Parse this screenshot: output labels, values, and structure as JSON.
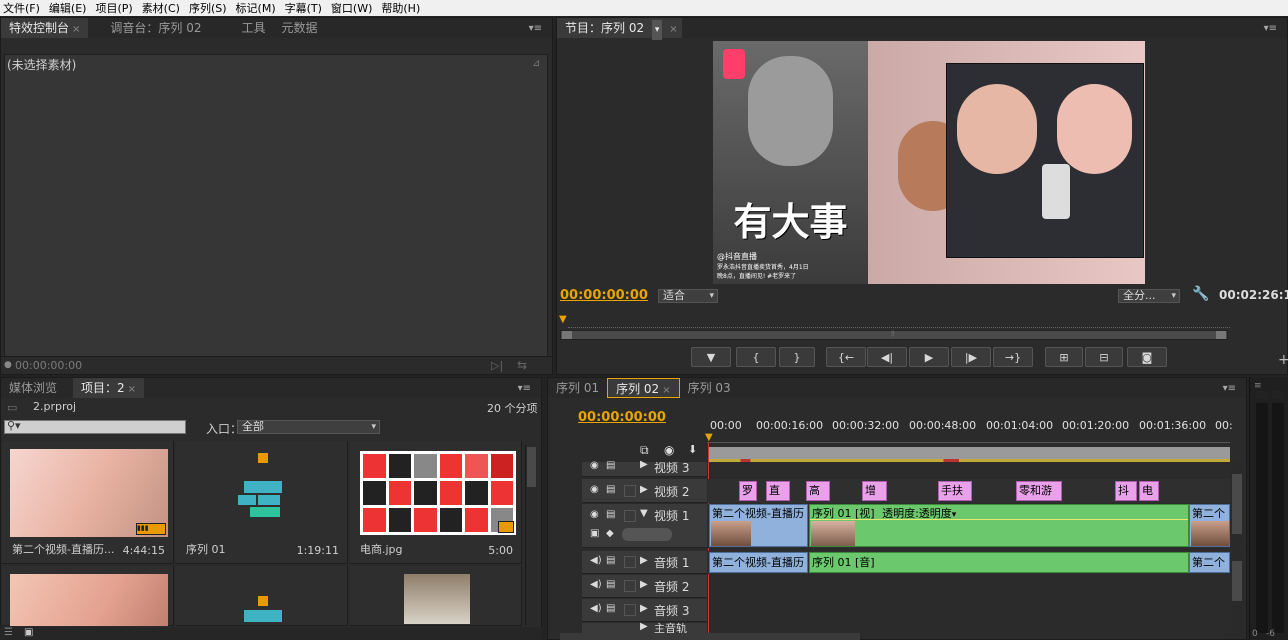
{
  "menu": [
    "文件(F)",
    "编辑(E)",
    "项目(P)",
    "素材(C)",
    "序列(S)",
    "标记(M)",
    "字幕(T)",
    "窗口(W)",
    "帮助(H)"
  ],
  "effects_panel": {
    "tabs": [
      "特效控制台",
      "调音台：序列 02",
      "工具",
      "元数据"
    ],
    "no_clip": "(未选择素材)",
    "timecode": "00:00:00:00"
  },
  "program_monitor": {
    "tab": "节目：序列 02",
    "timecode": "00:00:00:00",
    "fit": "适合",
    "quality": "全分...",
    "duration": "00:02:26:1",
    "video_text": {
      "headline": "有大事",
      "caption_user": "@抖音直播",
      "caption_line1": "罗永浩抖音直播卖货首秀，4月1日",
      "caption_line2": "晚8点，直播间见! #老罗来了"
    }
  },
  "project_panel": {
    "tabs": [
      "媒体浏览",
      "项目：2"
    ],
    "file": "2.prproj",
    "count": "20 个分项",
    "search_placeholder": "",
    "entry_label": "入口：",
    "entry_value": "全部",
    "items": [
      {
        "name": "第二个视频-直播历...",
        "duration": "4:44:15"
      },
      {
        "name": "序列 01",
        "duration": "1:19:11"
      },
      {
        "name": "电商.jpg",
        "duration": "5:00"
      }
    ]
  },
  "timeline": {
    "tabs": [
      "序列 01",
      "序列 02",
      "序列 03"
    ],
    "timecode": "00:00:00:00",
    "ruler": [
      "00:00",
      "00:00:16:00",
      "00:00:32:00",
      "00:00:48:00",
      "00:01:04:00",
      "00:01:20:00",
      "00:01:36:00",
      "00:"
    ],
    "tracks": {
      "v3": "视频 3",
      "v2": "视频 2",
      "v1": "视频 1",
      "a1": "音频 1",
      "a2": "音频 2",
      "a3": "音频 3",
      "master": "主音轨"
    },
    "v2_clips": [
      "罗",
      "直",
      "高",
      "增",
      "手扶",
      "零和游",
      "抖",
      "电"
    ],
    "v1_clips": {
      "first": "第二个视频-直播历",
      "seq": "序列 01 [视]",
      "opacity": "透明度:透明度",
      "last": "第二个"
    },
    "a1_clips": {
      "first": "第二个视频-直播历",
      "seq": "序列 01 [音]",
      "last": "第二个"
    }
  },
  "meter": {
    "labels": [
      "0",
      "-6"
    ]
  }
}
